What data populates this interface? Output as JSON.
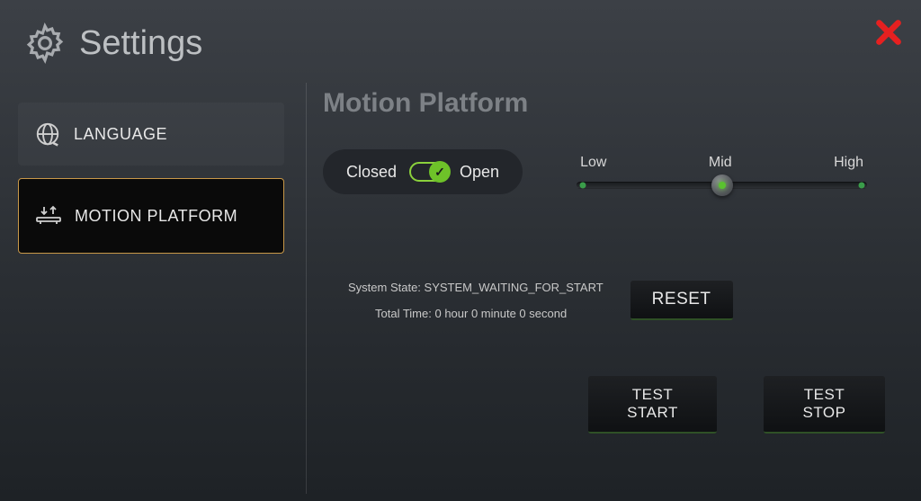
{
  "header": {
    "title": "Settings"
  },
  "sidebar": {
    "items": [
      {
        "label": "LANGUAGE",
        "active": false
      },
      {
        "label": "MOTION PLATFORM",
        "active": true
      }
    ]
  },
  "main": {
    "title": "Motion Platform",
    "toggle": {
      "left_label": "Closed",
      "right_label": "Open",
      "state": "open"
    },
    "slider": {
      "low_label": "Low",
      "mid_label": "Mid",
      "high_label": "High",
      "position": "mid"
    },
    "status": {
      "system_state_label": "System State:",
      "system_state_value": "SYSTEM_WAITING_FOR_START",
      "total_time_label": "Total Time:",
      "total_time_value": "0 hour 0 minute 0 second"
    },
    "buttons": {
      "reset": "RESET",
      "test_start": "TEST START",
      "test_stop": "TEST STOP"
    }
  }
}
